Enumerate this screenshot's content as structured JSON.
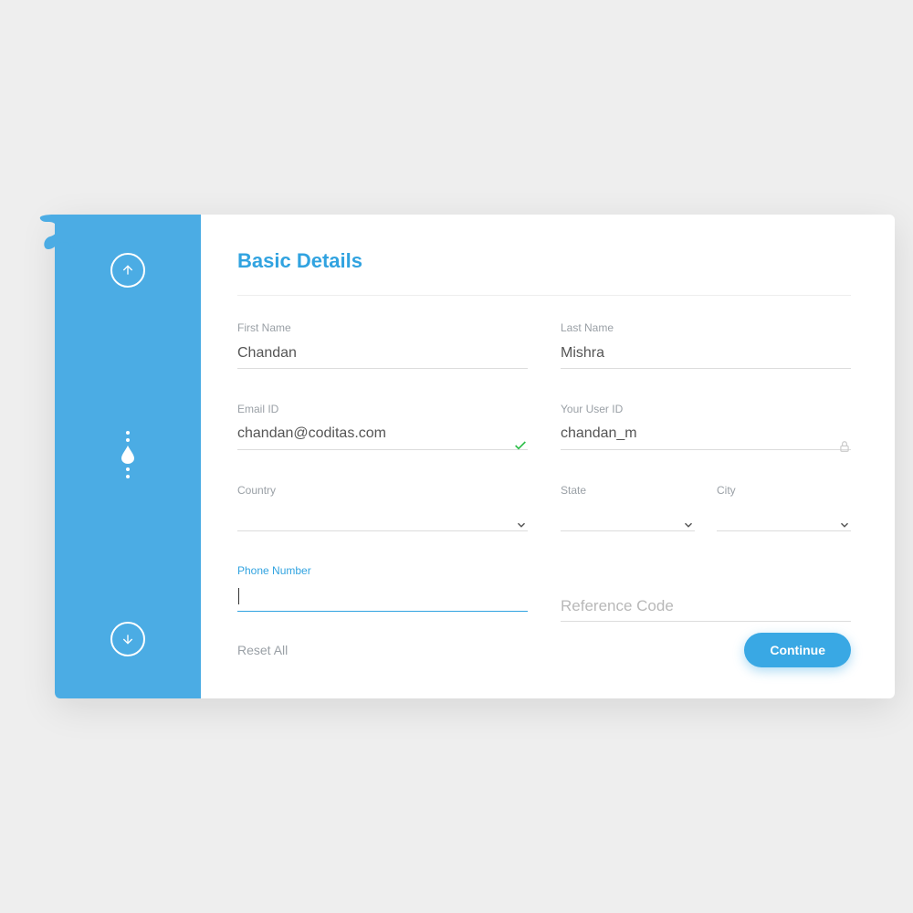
{
  "title": "Basic Details",
  "fields": {
    "first_name": {
      "label": "First Name",
      "value": "Chandan"
    },
    "last_name": {
      "label": "Last Name",
      "value": "Mishra"
    },
    "email": {
      "label": "Email ID",
      "value": "chandan@coditas.com",
      "valid": true
    },
    "user_id": {
      "label": "Your User ID",
      "value": "chandan_m",
      "locked": true
    },
    "country": {
      "label": "Country",
      "value": ""
    },
    "state": {
      "label": "State",
      "value": ""
    },
    "city": {
      "label": "City",
      "value": ""
    },
    "phone": {
      "label": "Phone Number",
      "value": ""
    },
    "reference": {
      "placeholder": "Reference Code",
      "value": ""
    }
  },
  "actions": {
    "reset": "Reset All",
    "continue": "Continue"
  },
  "colors": {
    "accent": "#39a8e4",
    "sidebar": "#4bace4"
  }
}
